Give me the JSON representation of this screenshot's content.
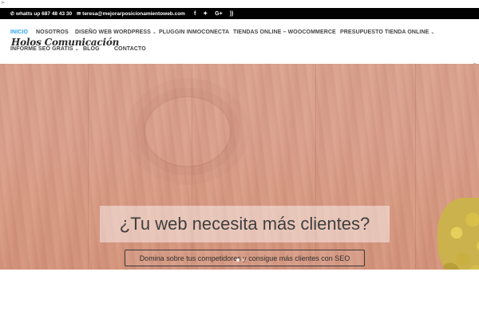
{
  "stray_text": ">",
  "topbar": {
    "phone_icon": "phone-icon",
    "phone": "whatts up 687 48 43 30",
    "email_icon": "envelope-icon",
    "email": "teresa@mejorarposicionamientoweb.com",
    "social": [
      {
        "name": "facebook-icon",
        "glyph": "f"
      },
      {
        "name": "twitter-icon",
        "glyph": "🐦"
      },
      {
        "name": "google-plus-icon",
        "glyph": "G+"
      },
      {
        "name": "rss-icon",
        "glyph": "⌇"
      }
    ]
  },
  "header": {
    "logo": "Holos Comunicación",
    "menu": [
      {
        "label": "INICIO",
        "active": true,
        "dropdown": false
      },
      {
        "label": "NOSOTROS",
        "active": false,
        "dropdown": false
      },
      {
        "label": "DISEÑO WEB WORDPRESS",
        "active": false,
        "dropdown": true
      },
      {
        "label": "PLUGGIN INMOCONECTA",
        "active": false,
        "dropdown": false
      },
      {
        "label": "TIENDAS ONLINE – WOOCOMMERCE",
        "active": false,
        "dropdown": false
      },
      {
        "label": "PRESUPUESTO TIENDA ONLINE",
        "active": false,
        "dropdown": true
      },
      {
        "label": "INFORME SEO GRATIS",
        "active": false,
        "dropdown": true
      },
      {
        "label": "BLOG",
        "active": false,
        "dropdown": false
      },
      {
        "label": "CONTACTO",
        "active": false,
        "dropdown": false
      }
    ],
    "search_icon": "search-icon"
  },
  "hero": {
    "title": "¿Tu web necesita más clientes?",
    "cta_label": "Domina sobre tus competidores y consigue más clientes con SEO"
  },
  "colors": {
    "accent": "#2ea3f2",
    "topbar_bg": "#000000",
    "menu_text": "#444444"
  }
}
